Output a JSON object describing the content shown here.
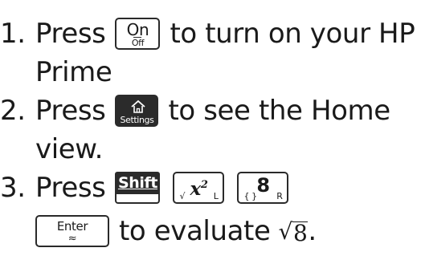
{
  "steps": [
    {
      "number": "1.",
      "text_before": "Press",
      "key": {
        "main": "On",
        "sub": "Off"
      },
      "text_after": "to turn on your HP",
      "continuation": "Prime"
    },
    {
      "number": "2.",
      "text_before": "Press",
      "key": {
        "icon": "home-icon",
        "sub": "Settings"
      },
      "text_after": "to see the Home",
      "continuation": "view."
    },
    {
      "number": "3.",
      "text_before": "Press",
      "keys": [
        {
          "main": "Shift"
        },
        {
          "main": "x",
          "sup": "2",
          "sub_left": "√",
          "sub_right": "L"
        },
        {
          "main": "8",
          "sub_left": "{ }",
          "sub_right": "R"
        }
      ],
      "enter_key": {
        "main": "Enter",
        "sub": "≈"
      },
      "text_after": "to evaluate",
      "math": {
        "radical": "√",
        "radicand": "8",
        "trailing": "."
      }
    }
  ],
  "colors": {
    "text": "#1a1a1a",
    "key_dark": "#2b2b2b",
    "key_outline": "#2a2a2a",
    "background": "#ffffff"
  }
}
